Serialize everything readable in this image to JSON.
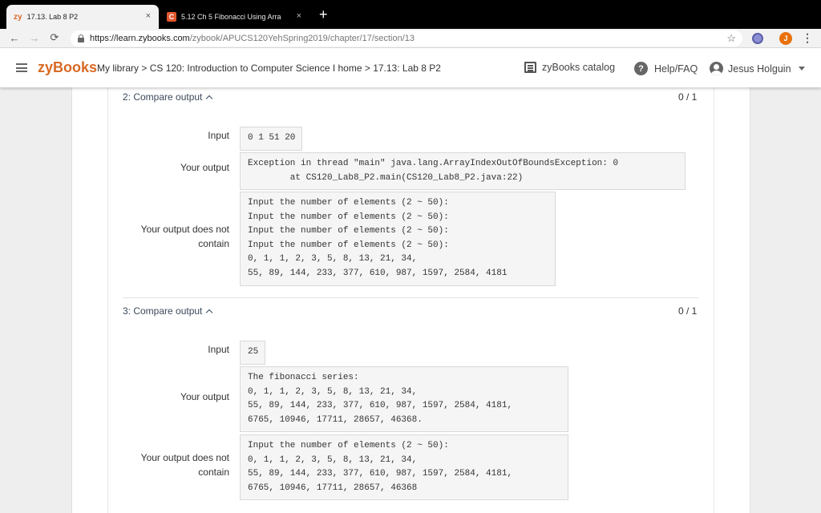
{
  "browser": {
    "tabs": [
      {
        "favicon": "zy",
        "title": "17.13. Lab 8 P2",
        "close": "×"
      },
      {
        "favicon": "C",
        "title": "5.12 Ch 5 Fibonacci Using Arra",
        "close": "×"
      }
    ],
    "new_tab": "+",
    "nav": {
      "back": "←",
      "forward": "→",
      "reload": "⟳"
    },
    "url_host": "https://learn.zybooks.com",
    "url_path": "/zybook/APUCS120YehSpring2019/chapter/17/section/13",
    "star": "☆",
    "profile_initial": "J",
    "menu": "⋮"
  },
  "header": {
    "brand": "zyBooks",
    "breadcrumb": {
      "my_library": "My library",
      "sep1": " > ",
      "course": "CS 120: Introduction to Computer Science I home",
      "sep2": " > ",
      "section": "17.13: Lab 8 P2"
    },
    "catalog": "zyBooks catalog",
    "help": "Help/FAQ",
    "help_glyph": "?",
    "user": "Jesus Holguin"
  },
  "sections": [
    {
      "title": "2: Compare output",
      "score": "0 / 1",
      "input_label": "Input",
      "input": "0 1 51 20",
      "your_output_label": "Your output",
      "your_output": "Exception in thread \"main\" java.lang.ArrayIndexOutOfBoundsException: 0\n        at CS120_Lab8_P2.main(CS120_Lab8_P2.java:22)",
      "not_contain_label": "Your output does not\ncontain",
      "expected": "Input the number of elements (2 ~ 50):\nInput the number of elements (2 ~ 50):\nInput the number of elements (2 ~ 50):\nInput the number of elements (2 ~ 50):\n0, 1, 1, 2, 3, 5, 8, 13, 21, 34,\n55, 89, 144, 233, 377, 610, 987, 1597, 2584, 4181"
    },
    {
      "title": "3: Compare output",
      "score": "0 / 1",
      "input_label": "Input",
      "input": "25",
      "your_output_label": "Your output",
      "your_output": "The fibonacci series:\n0, 1, 1, 2, 3, 5, 8, 13, 21, 34,\n55, 89, 144, 233, 377, 610, 987, 1597, 2584, 4181,\n6765, 10946, 17711, 28657, 46368.",
      "not_contain_label": "Your output does not\ncontain",
      "expected": "Input the number of elements (2 ~ 50):\n0, 1, 1, 2, 3, 5, 8, 13, 21, 34,\n55, 89, 144, 233, 377, 610, 987, 1597, 2584, 4181,\n6765, 10946, 17711, 28657, 46368"
    }
  ],
  "colors": {
    "brand": "#d86a23",
    "tab_strip": "#000000",
    "page_bg": "#eeeeee",
    "code_bg": "#f5f5f5"
  }
}
